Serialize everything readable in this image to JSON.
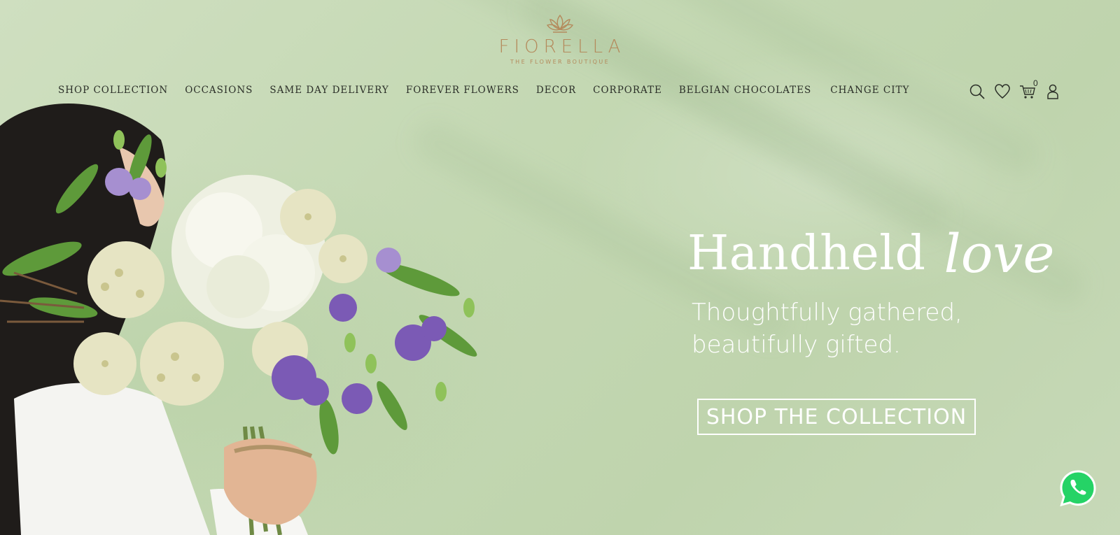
{
  "brand": {
    "name": "FIORELLA",
    "tagline": "THE FLOWER BOUTIQUE",
    "accent_color": "#b48a5c"
  },
  "nav": {
    "items": [
      {
        "label": "SHOP COLLECTION"
      },
      {
        "label": "OCCASIONS"
      },
      {
        "label": "SAME DAY DELIVERY"
      },
      {
        "label": "FOREVER FLOWERS"
      },
      {
        "label": "DECOR"
      },
      {
        "label": "CORPORATE"
      },
      {
        "label": "BELGIAN CHOCOLATES"
      },
      {
        "label": "CHANGE CITY"
      }
    ]
  },
  "header_icons": {
    "search": "search-icon",
    "wishlist": "heart-icon",
    "cart": "cart-icon",
    "account": "user-icon",
    "cart_count": "0"
  },
  "hero": {
    "headline": "Handheld",
    "headline_script": "love",
    "subline_1": "Thoughtfully gathered,",
    "subline_2": "beautifully gifted.",
    "cta_label": "SHOP THE COLLECTION",
    "background_color": "#c8d9b8",
    "text_color": "#ffffff"
  },
  "floating": {
    "whatsapp": "whatsapp-icon",
    "whatsapp_color": "#25d366"
  }
}
